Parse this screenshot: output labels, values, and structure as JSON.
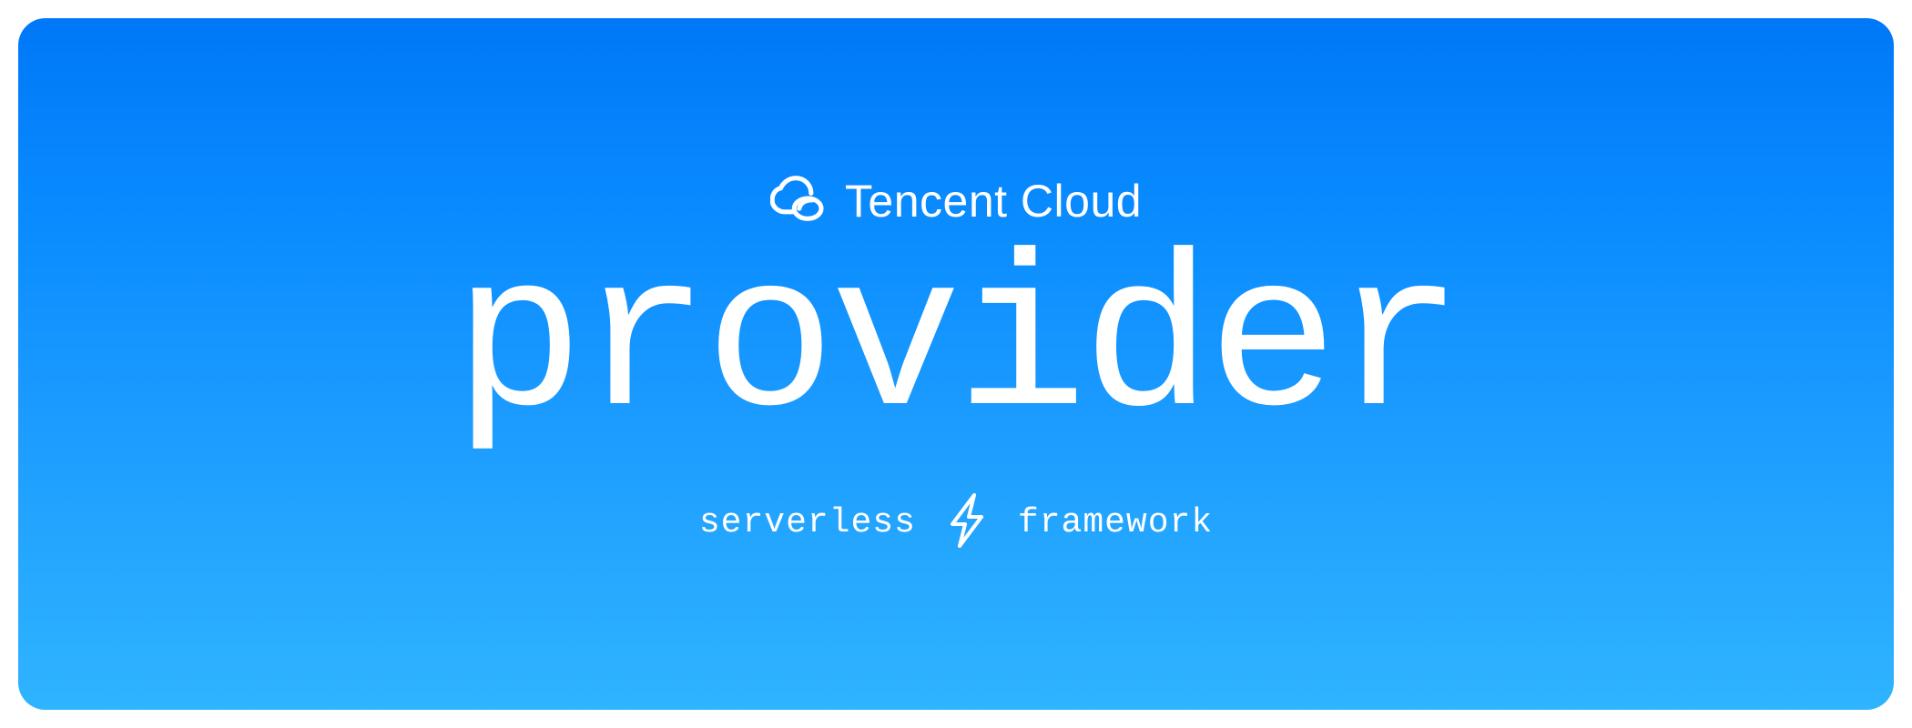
{
  "brand": {
    "label": "Tencent Cloud"
  },
  "title": "provider",
  "framework": {
    "left": "serverless",
    "right": "framework"
  }
}
